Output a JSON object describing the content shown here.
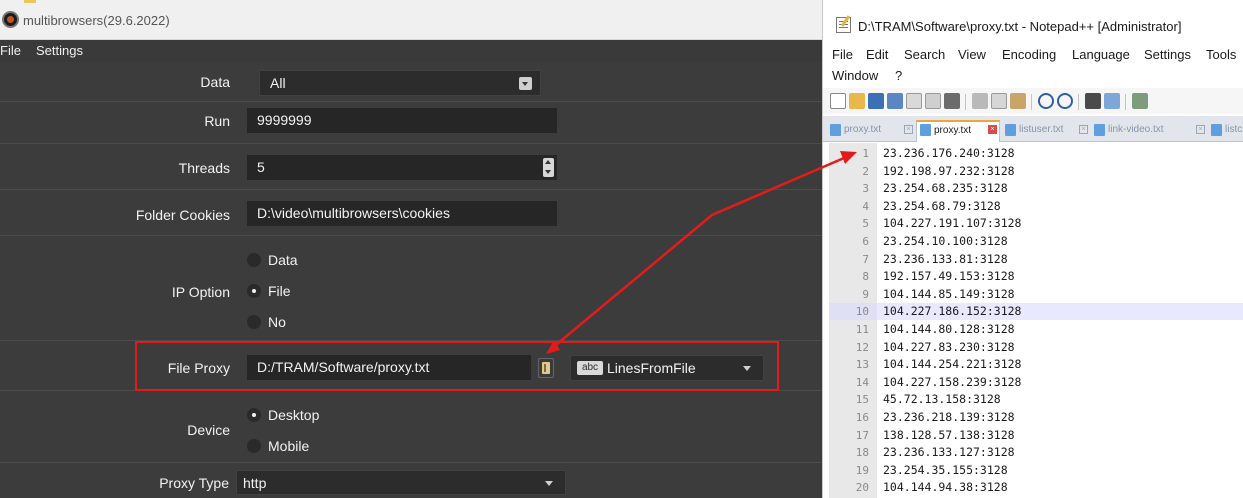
{
  "app": {
    "title": "multibrowsers(29.6.2022)",
    "menu": [
      "File",
      "Settings"
    ]
  },
  "form": {
    "data_label": "Data",
    "data_value": "All",
    "run_label": "Run",
    "run_value": "9999999",
    "threads_label": "Threads",
    "threads_value": "5",
    "folder_label": "Folder Cookies",
    "folder_value": "D:\\video\\multibrowsers\\cookies",
    "ip_label": "IP Option",
    "ip_options": [
      {
        "label": "Data",
        "selected": false
      },
      {
        "label": "File",
        "selected": true
      },
      {
        "label": "No",
        "selected": false
      }
    ],
    "proxy_label": "File Proxy",
    "proxy_value": "D:/TRAM/Software/proxy.txt",
    "proxy_mode_badge": "abc",
    "proxy_mode": "LinesFromFile",
    "device_label": "Device",
    "device_options": [
      {
        "label": "Desktop",
        "selected": true
      },
      {
        "label": "Mobile",
        "selected": false
      }
    ],
    "proxytype_label": "Proxy Type",
    "proxytype_value": "http"
  },
  "notepad": {
    "title": "D:\\TRAM\\Software\\proxy.txt - Notepad++ [Administrator]",
    "menu": [
      "File",
      "Edit",
      "Search",
      "View",
      "Encoding",
      "Language",
      "Settings",
      "Tools"
    ],
    "menu2": [
      "Window",
      "?"
    ],
    "tabs": [
      {
        "label": "proxy.txt",
        "active": false
      },
      {
        "label": "proxy.txt",
        "active": true
      },
      {
        "label": "listuser.txt",
        "active": false
      },
      {
        "label": "link-video.txt",
        "active": false
      },
      {
        "label": "listc",
        "active": false
      }
    ],
    "lines": [
      "23.236.176.240:3128",
      "192.198.97.232:3128",
      "23.254.68.235:3128",
      "23.254.68.79:3128",
      "104.227.191.107:3128",
      "23.254.10.100:3128",
      "23.236.133.81:3128",
      "192.157.49.153:3128",
      "104.144.85.149:3128",
      "104.227.186.152:3128",
      "104.144.80.128:3128",
      "104.227.83.230:3128",
      "104.144.254.221:3128",
      "104.227.158.239:3128",
      "45.72.13.158:3128",
      "23.236.218.139:3128",
      "138.128.57.138:3128",
      "23.236.133.127:3128",
      "23.254.35.155:3128",
      "104.144.94.38:3128"
    ],
    "line_numbers": [
      "1",
      "2",
      "3",
      "4",
      "5",
      "6",
      "7",
      "8",
      "9",
      "10",
      "11",
      "12",
      "13",
      "14",
      "15",
      "16",
      "17",
      "18",
      "19",
      "20"
    ],
    "highlighted_line": 10
  },
  "colors": {
    "annotation_red": "#e41b1b",
    "dark_bg": "#3c3c3c",
    "field_bg": "#262626",
    "active_tab_accent": "#f0a53a"
  }
}
